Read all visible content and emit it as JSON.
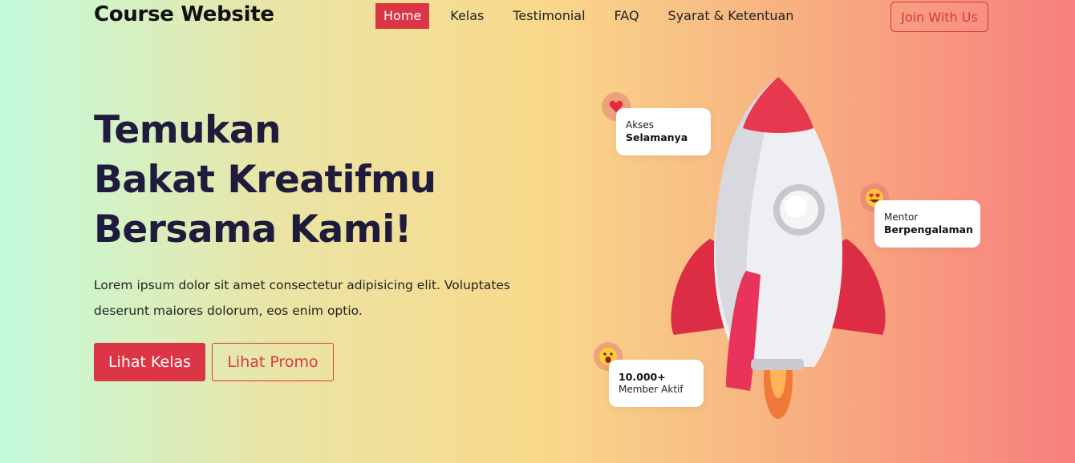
{
  "header": {
    "brand": "Course Website",
    "nav": [
      "Home",
      "Kelas",
      "Testimonial",
      "FAQ",
      "Syarat & Ketentuan"
    ],
    "active_nav": "Home",
    "join_label": "Join With Us"
  },
  "hero": {
    "title_lines": [
      "Temukan",
      "Bakat Kreatifmu",
      "Bersama Kami!"
    ],
    "description": "Lorem ipsum dolor sit amet consectetur adipisicing elit. Voluptates deserunt maiores dolorum, eos enim optio.",
    "primary_button": "Lihat Kelas",
    "secondary_button": "Lihat Promo"
  },
  "cards": [
    {
      "line1": "Akses",
      "line2": "Selamanya",
      "icon": "heart-icon"
    },
    {
      "line1": "Mentor",
      "line2": "Berpengalaman",
      "icon": "heart-eyes-emoji-icon"
    },
    {
      "line1": "10.000+",
      "line2": "Member Aktif",
      "icon": "shocked-emoji-icon"
    }
  ],
  "colors": {
    "accent": "#dc3545",
    "title": "#1f1b3d",
    "gradient": [
      "#c4fbdd",
      "#f9d98b",
      "#f77f7e"
    ]
  }
}
